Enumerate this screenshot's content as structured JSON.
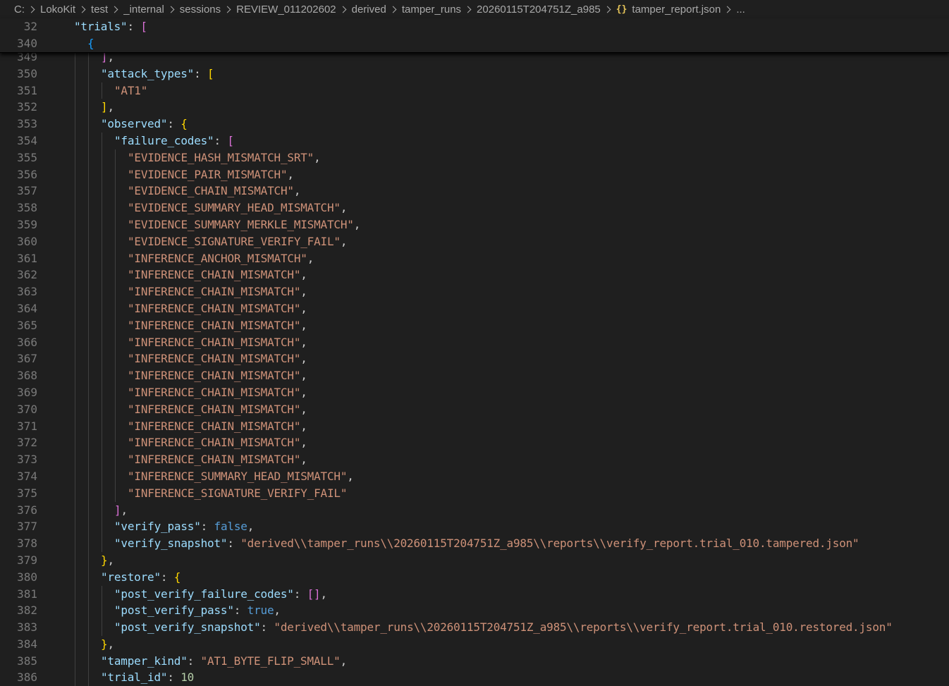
{
  "breadcrumb": {
    "items": [
      "C:",
      "LokoKit",
      "test",
      "_internal",
      "sessions",
      "REVIEW_011202602",
      "derived",
      "tamper_runs",
      "20260115T204751Z_a985"
    ],
    "file_icon": "{}",
    "file": "tamper_report.json",
    "overflow": "..."
  },
  "colors": {
    "background": "#1f1f1f",
    "key": "#9cdcfe",
    "string": "#ce9178",
    "keyword": "#569cd6",
    "number": "#b5cea8",
    "bracket_gold": "#ffd700",
    "bracket_purple": "#da70d6",
    "bracket_blue": "#179fff",
    "line_number": "#7a7a7a"
  },
  "sticky_lines": [
    {
      "num": "32",
      "indent": 2,
      "tokens": [
        {
          "t": "\"trials\"",
          "c": "k"
        },
        {
          "t": ": ",
          "c": "p"
        },
        {
          "t": "[",
          "c": "b2"
        }
      ]
    },
    {
      "num": "340",
      "indent": 3,
      "tokens": [
        {
          "t": "{",
          "c": "b3"
        }
      ]
    }
  ],
  "lines": [
    {
      "num": "349",
      "indent": 4,
      "tokens": [
        {
          "t": "]",
          "c": "b2"
        },
        {
          "t": ",",
          "c": "p"
        }
      ]
    },
    {
      "num": "350",
      "indent": 4,
      "tokens": [
        {
          "t": "\"attack_types\"",
          "c": "k"
        },
        {
          "t": ": ",
          "c": "p"
        },
        {
          "t": "[",
          "c": "b1"
        }
      ]
    },
    {
      "num": "351",
      "indent": 5,
      "tokens": [
        {
          "t": "\"AT1\"",
          "c": "s"
        }
      ]
    },
    {
      "num": "352",
      "indent": 4,
      "tokens": [
        {
          "t": "]",
          "c": "b1"
        },
        {
          "t": ",",
          "c": "p"
        }
      ]
    },
    {
      "num": "353",
      "indent": 4,
      "tokens": [
        {
          "t": "\"observed\"",
          "c": "k"
        },
        {
          "t": ": ",
          "c": "p"
        },
        {
          "t": "{",
          "c": "b1"
        }
      ]
    },
    {
      "num": "354",
      "indent": 5,
      "tokens": [
        {
          "t": "\"failure_codes\"",
          "c": "k"
        },
        {
          "t": ": ",
          "c": "p"
        },
        {
          "t": "[",
          "c": "b2"
        }
      ]
    },
    {
      "num": "355",
      "indent": 6,
      "tokens": [
        {
          "t": "\"EVIDENCE_HASH_MISMATCH_SRT\"",
          "c": "s"
        },
        {
          "t": ",",
          "c": "p"
        }
      ]
    },
    {
      "num": "356",
      "indent": 6,
      "tokens": [
        {
          "t": "\"EVIDENCE_PAIR_MISMATCH\"",
          "c": "s"
        },
        {
          "t": ",",
          "c": "p"
        }
      ]
    },
    {
      "num": "357",
      "indent": 6,
      "tokens": [
        {
          "t": "\"EVIDENCE_CHAIN_MISMATCH\"",
          "c": "s"
        },
        {
          "t": ",",
          "c": "p"
        }
      ]
    },
    {
      "num": "358",
      "indent": 6,
      "tokens": [
        {
          "t": "\"EVIDENCE_SUMMARY_HEAD_MISMATCH\"",
          "c": "s"
        },
        {
          "t": ",",
          "c": "p"
        }
      ]
    },
    {
      "num": "359",
      "indent": 6,
      "tokens": [
        {
          "t": "\"EVIDENCE_SUMMARY_MERKLE_MISMATCH\"",
          "c": "s"
        },
        {
          "t": ",",
          "c": "p"
        }
      ]
    },
    {
      "num": "360",
      "indent": 6,
      "tokens": [
        {
          "t": "\"EVIDENCE_SIGNATURE_VERIFY_FAIL\"",
          "c": "s"
        },
        {
          "t": ",",
          "c": "p"
        }
      ]
    },
    {
      "num": "361",
      "indent": 6,
      "tokens": [
        {
          "t": "\"INFERENCE_ANCHOR_MISMATCH\"",
          "c": "s"
        },
        {
          "t": ",",
          "c": "p"
        }
      ]
    },
    {
      "num": "362",
      "indent": 6,
      "tokens": [
        {
          "t": "\"INFERENCE_CHAIN_MISMATCH\"",
          "c": "s"
        },
        {
          "t": ",",
          "c": "p"
        }
      ]
    },
    {
      "num": "363",
      "indent": 6,
      "tokens": [
        {
          "t": "\"INFERENCE_CHAIN_MISMATCH\"",
          "c": "s"
        },
        {
          "t": ",",
          "c": "p"
        }
      ]
    },
    {
      "num": "364",
      "indent": 6,
      "tokens": [
        {
          "t": "\"INFERENCE_CHAIN_MISMATCH\"",
          "c": "s"
        },
        {
          "t": ",",
          "c": "p"
        }
      ]
    },
    {
      "num": "365",
      "indent": 6,
      "tokens": [
        {
          "t": "\"INFERENCE_CHAIN_MISMATCH\"",
          "c": "s"
        },
        {
          "t": ",",
          "c": "p"
        }
      ]
    },
    {
      "num": "366",
      "indent": 6,
      "tokens": [
        {
          "t": "\"INFERENCE_CHAIN_MISMATCH\"",
          "c": "s"
        },
        {
          "t": ",",
          "c": "p"
        }
      ]
    },
    {
      "num": "367",
      "indent": 6,
      "tokens": [
        {
          "t": "\"INFERENCE_CHAIN_MISMATCH\"",
          "c": "s"
        },
        {
          "t": ",",
          "c": "p"
        }
      ]
    },
    {
      "num": "368",
      "indent": 6,
      "tokens": [
        {
          "t": "\"INFERENCE_CHAIN_MISMATCH\"",
          "c": "s"
        },
        {
          "t": ",",
          "c": "p"
        }
      ]
    },
    {
      "num": "369",
      "indent": 6,
      "tokens": [
        {
          "t": "\"INFERENCE_CHAIN_MISMATCH\"",
          "c": "s"
        },
        {
          "t": ",",
          "c": "p"
        }
      ]
    },
    {
      "num": "370",
      "indent": 6,
      "tokens": [
        {
          "t": "\"INFERENCE_CHAIN_MISMATCH\"",
          "c": "s"
        },
        {
          "t": ",",
          "c": "p"
        }
      ]
    },
    {
      "num": "371",
      "indent": 6,
      "tokens": [
        {
          "t": "\"INFERENCE_CHAIN_MISMATCH\"",
          "c": "s"
        },
        {
          "t": ",",
          "c": "p"
        }
      ]
    },
    {
      "num": "372",
      "indent": 6,
      "tokens": [
        {
          "t": "\"INFERENCE_CHAIN_MISMATCH\"",
          "c": "s"
        },
        {
          "t": ",",
          "c": "p"
        }
      ]
    },
    {
      "num": "373",
      "indent": 6,
      "tokens": [
        {
          "t": "\"INFERENCE_CHAIN_MISMATCH\"",
          "c": "s"
        },
        {
          "t": ",",
          "c": "p"
        }
      ]
    },
    {
      "num": "374",
      "indent": 6,
      "tokens": [
        {
          "t": "\"INFERENCE_SUMMARY_HEAD_MISMATCH\"",
          "c": "s"
        },
        {
          "t": ",",
          "c": "p"
        }
      ]
    },
    {
      "num": "375",
      "indent": 6,
      "tokens": [
        {
          "t": "\"INFERENCE_SIGNATURE_VERIFY_FAIL\"",
          "c": "s"
        }
      ]
    },
    {
      "num": "376",
      "indent": 5,
      "tokens": [
        {
          "t": "]",
          "c": "b2"
        },
        {
          "t": ",",
          "c": "p"
        }
      ]
    },
    {
      "num": "377",
      "indent": 5,
      "tokens": [
        {
          "t": "\"verify_pass\"",
          "c": "k"
        },
        {
          "t": ": ",
          "c": "p"
        },
        {
          "t": "false",
          "c": "kw"
        },
        {
          "t": ",",
          "c": "p"
        }
      ]
    },
    {
      "num": "378",
      "indent": 5,
      "tokens": [
        {
          "t": "\"verify_snapshot\"",
          "c": "k"
        },
        {
          "t": ": ",
          "c": "p"
        },
        {
          "t": "\"derived\\\\tamper_runs\\\\20260115T204751Z_a985\\\\reports\\\\verify_report.trial_010.tampered.json\"",
          "c": "s"
        }
      ]
    },
    {
      "num": "379",
      "indent": 4,
      "tokens": [
        {
          "t": "}",
          "c": "b1"
        },
        {
          "t": ",",
          "c": "p"
        }
      ]
    },
    {
      "num": "380",
      "indent": 4,
      "tokens": [
        {
          "t": "\"restore\"",
          "c": "k"
        },
        {
          "t": ": ",
          "c": "p"
        },
        {
          "t": "{",
          "c": "b1"
        }
      ]
    },
    {
      "num": "381",
      "indent": 5,
      "tokens": [
        {
          "t": "\"post_verify_failure_codes\"",
          "c": "k"
        },
        {
          "t": ": ",
          "c": "p"
        },
        {
          "t": "[]",
          "c": "b2"
        },
        {
          "t": ",",
          "c": "p"
        }
      ]
    },
    {
      "num": "382",
      "indent": 5,
      "tokens": [
        {
          "t": "\"post_verify_pass\"",
          "c": "k"
        },
        {
          "t": ": ",
          "c": "p"
        },
        {
          "t": "true",
          "c": "kw"
        },
        {
          "t": ",",
          "c": "p"
        }
      ]
    },
    {
      "num": "383",
      "indent": 5,
      "tokens": [
        {
          "t": "\"post_verify_snapshot\"",
          "c": "k"
        },
        {
          "t": ": ",
          "c": "p"
        },
        {
          "t": "\"derived\\\\tamper_runs\\\\20260115T204751Z_a985\\\\reports\\\\verify_report.trial_010.restored.json\"",
          "c": "s"
        }
      ]
    },
    {
      "num": "384",
      "indent": 4,
      "tokens": [
        {
          "t": "}",
          "c": "b1"
        },
        {
          "t": ",",
          "c": "p"
        }
      ]
    },
    {
      "num": "385",
      "indent": 4,
      "tokens": [
        {
          "t": "\"tamper_kind\"",
          "c": "k"
        },
        {
          "t": ": ",
          "c": "p"
        },
        {
          "t": "\"AT1_BYTE_FLIP_SMALL\"",
          "c": "s"
        },
        {
          "t": ",",
          "c": "p"
        }
      ]
    },
    {
      "num": "386",
      "indent": 4,
      "tokens": [
        {
          "t": "\"trial_id\"",
          "c": "k"
        },
        {
          "t": ": ",
          "c": "p"
        },
        {
          "t": "10",
          "c": "n"
        }
      ]
    }
  ]
}
